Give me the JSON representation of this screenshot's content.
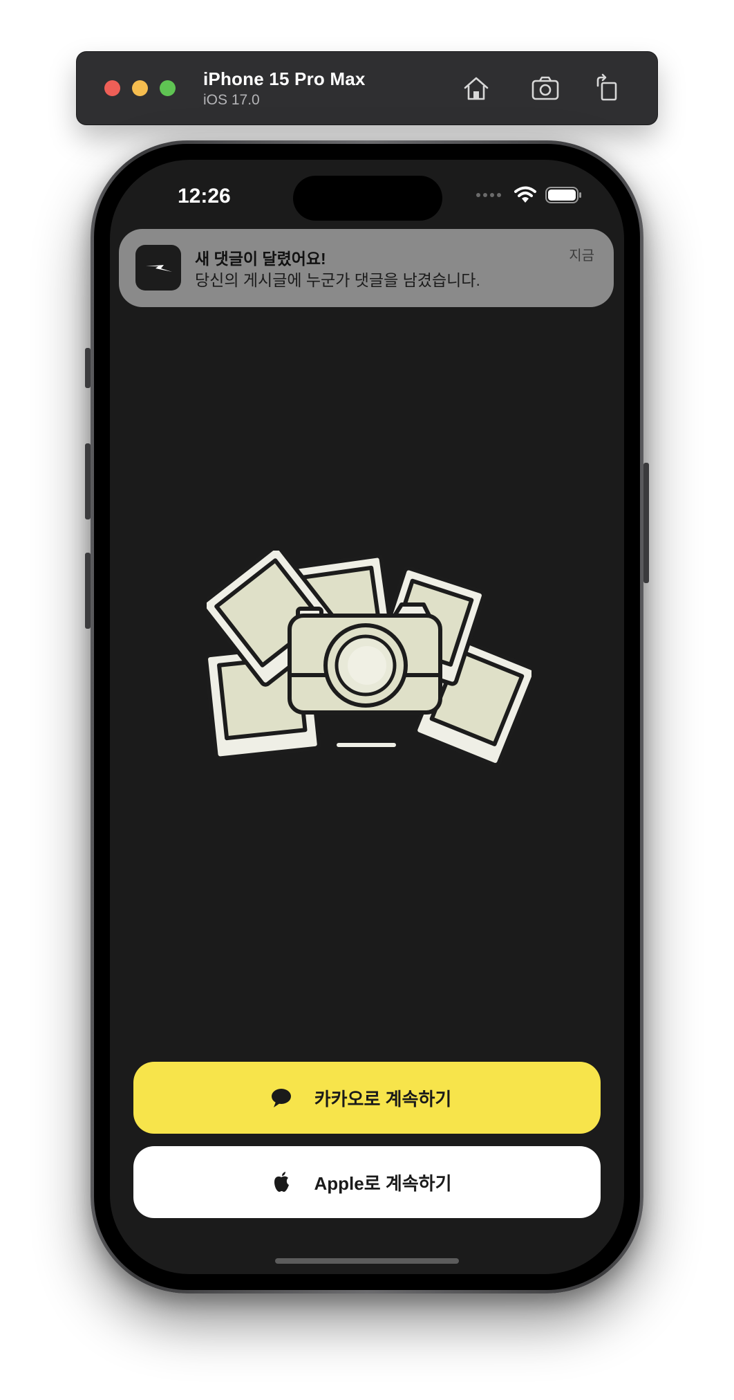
{
  "simulator": {
    "device_name": "iPhone 15 Pro Max",
    "os_version": "iOS 17.0",
    "buttons": [
      "home-icon",
      "screenshot-icon",
      "rotate-icon"
    ]
  },
  "status_bar": {
    "time": "12:26"
  },
  "notification": {
    "title": "새 댓글이 달렸어요!",
    "body": "당신의 게시글에 누군가 댓글을 남겼습니다.",
    "time": "지금"
  },
  "login": {
    "kakao_label": "카카오로 계속하기",
    "apple_label": "Apple로 계속하기"
  },
  "colors": {
    "screen_bg": "#1b1b1b",
    "kakao_yellow": "#f7e44b",
    "apple_white": "#ffffff",
    "illustration_fill": "#dfe0c8"
  }
}
